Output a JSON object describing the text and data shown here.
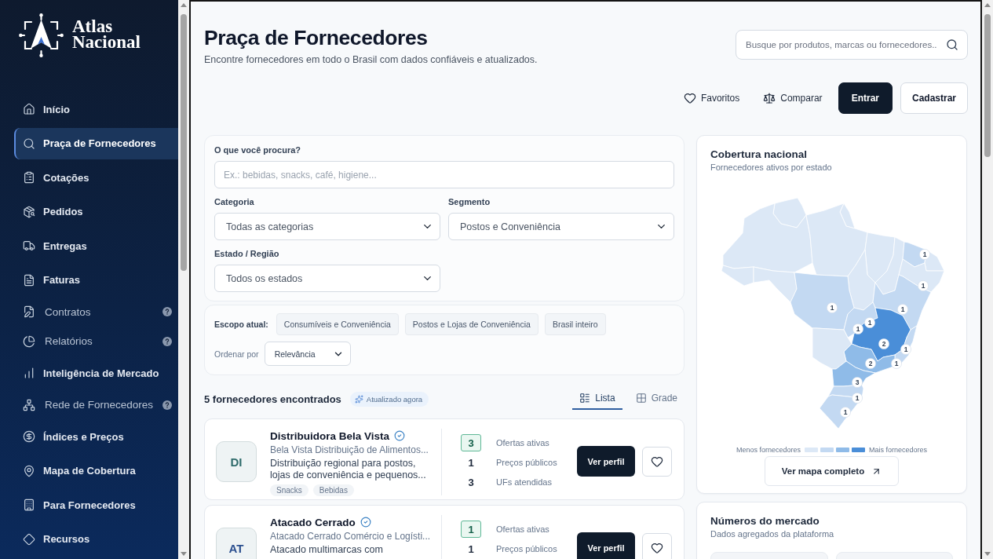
{
  "sidebar": {
    "brand": {
      "name": "Atlas Nacional"
    },
    "items": [
      {
        "label": "Início",
        "kind": "main",
        "selected": false
      },
      {
        "label": "Praça de Fornecedores",
        "kind": "main",
        "selected": true
      },
      {
        "label": "Cotações",
        "kind": "main",
        "selected": false
      },
      {
        "label": "Pedidos",
        "kind": "main",
        "selected": false
      },
      {
        "label": "Entregas",
        "kind": "main",
        "selected": false
      },
      {
        "label": "Faturas",
        "kind": "main",
        "selected": false
      },
      {
        "label": "Contratos",
        "kind": "help",
        "selected": false
      },
      {
        "label": "Relatórios",
        "kind": "help",
        "selected": false
      },
      {
        "label": "Inteligência de Mercado",
        "kind": "main",
        "selected": false
      },
      {
        "label": "Rede de Fornecedores",
        "kind": "help",
        "selected": false
      },
      {
        "label": "Índices e Preços",
        "kind": "main",
        "selected": false
      },
      {
        "label": "Mapa de Cobertura",
        "kind": "main",
        "selected": false
      },
      {
        "label": "Para Fornecedores",
        "kind": "main",
        "selected": false
      },
      {
        "label": "Recursos",
        "kind": "main",
        "selected": false
      }
    ]
  },
  "header": {
    "title": "Praça de Fornecedores",
    "subtitle": "Encontre fornecedores em todo o Brasil com dados confiáveis e atualizados.",
    "search": {
      "placeholder": "Busque por produtos, marcas ou fornecedores.."
    },
    "actions": [
      {
        "label": "Favoritos",
        "kind": "link"
      },
      {
        "label": "Comparar",
        "kind": "link"
      },
      {
        "label": "Entrar",
        "kind": "primary"
      },
      {
        "label": "Cadastrar",
        "kind": "secondary"
      }
    ]
  },
  "filters": {
    "query": {
      "label": "O que você procura?",
      "placeholder": "Ex.: bebidas, snacks, café, higiene..."
    },
    "selects": [
      {
        "label": "Categoria",
        "value": "Todas as categorias"
      },
      {
        "label": "Segmento",
        "value": "Postos e Conveniência"
      },
      {
        "label": "Estado / Região",
        "value": "Todos os estados"
      }
    ]
  },
  "scope": {
    "label": "Escopo atual:",
    "chips": [
      "Consumíveis e Conveniência",
      "Postos e Lojas de Conveniência",
      "Brasil inteiro"
    ],
    "sort": {
      "label": "Ordenar por",
      "value": "Relevância"
    }
  },
  "results": {
    "count": "5 fornecedores encontrados",
    "badge": "Atualizado agora",
    "views": [
      {
        "label": "Lista",
        "selected": true
      },
      {
        "label": "Grade",
        "selected": false
      }
    ],
    "suppliers": [
      {
        "initials": "DI",
        "color": "#2f6b6b",
        "name": "Distribuidora Bela Vista",
        "verified": true,
        "legal_name": "Bela Vista Distribuição de Alimentos...",
        "description": "Distribuição regional para postos, lojas de conveniência e pequenos...",
        "tags": [
          "Snacks",
          "Bebidas"
        ],
        "stats": [
          {
            "value": "3",
            "label": "Ofertas ativas",
            "highlighted": true
          },
          {
            "value": "1",
            "label": "Preços públicos",
            "highlighted": false
          },
          {
            "value": "3",
            "label": "UFs atendidas",
            "highlighted": false
          }
        ],
        "button": "Ver perfil"
      },
      {
        "initials": "AT",
        "color": "#2b4f8f",
        "name": "Atacado Cerrado",
        "verified": true,
        "legal_name": "Atacado Cerrado Comércio e Logísti...",
        "description": "Atacado multimarcas com",
        "stats": [
          {
            "value": "1",
            "label": "Ofertas ativas",
            "highlighted": true
          },
          {
            "value": "1",
            "label": "Preços públicos",
            "highlighted": false
          }
        ],
        "button": "Ver perfil"
      }
    ]
  },
  "coverage": {
    "title": "Cobertura nacional",
    "subtitle": "Fornecedores ativos por estado",
    "markers": [
      {
        "count": "1"
      },
      {
        "count": "1"
      },
      {
        "count": "1"
      },
      {
        "count": "1"
      },
      {
        "count": "1"
      },
      {
        "count": "1"
      },
      {
        "count": "2"
      },
      {
        "count": "1"
      },
      {
        "count": "1"
      },
      {
        "count": "2"
      },
      {
        "count": "3"
      },
      {
        "count": "1"
      },
      {
        "count": "1"
      }
    ],
    "legend": {
      "low_label": "Menos fornecedores",
      "high_label": "Mais fornecedores",
      "swatches": [
        {
          "color": "#dce8f6"
        },
        {
          "color": "#c3d9f2"
        },
        {
          "color": "#8fbbe8"
        },
        {
          "color": "#4a8ed8"
        }
      ]
    },
    "button": "Ver mapa completo"
  },
  "market": {
    "title": "Números do mercado",
    "subtitle": "Dados agregados da plataforma"
  }
}
